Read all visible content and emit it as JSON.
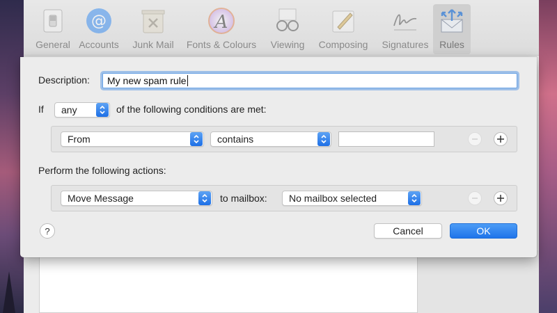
{
  "toolbar": {
    "items": [
      {
        "label": "General",
        "icon": "general-switch-icon"
      },
      {
        "label": "Accounts",
        "icon": "at-sign-icon"
      },
      {
        "label": "Junk Mail",
        "icon": "trash-x-icon"
      },
      {
        "label": "Fonts & Colours",
        "icon": "font-colour-icon"
      },
      {
        "label": "Viewing",
        "icon": "glasses-icon"
      },
      {
        "label": "Composing",
        "icon": "pencil-icon"
      },
      {
        "label": "Signatures",
        "icon": "signature-icon"
      },
      {
        "label": "Rules",
        "icon": "rules-envelope-icon"
      }
    ],
    "selected": "Rules"
  },
  "rule_sheet": {
    "description_label": "Description:",
    "description_value": "My new spam rule",
    "if_label": "If",
    "match_selector": "any",
    "conditions_suffix": "of the following conditions are met:",
    "condition": {
      "field": "From",
      "operator": "contains",
      "value": ""
    },
    "actions_label": "Perform the following actions:",
    "action": {
      "type": "Move Message",
      "to_label": "to mailbox:",
      "mailbox": "No mailbox selected"
    },
    "help_label": "?",
    "cancel_label": "Cancel",
    "ok_label": "OK"
  },
  "colors": {
    "accent": "#1f74ea",
    "focus_ring": "#6aa2e4",
    "sheet_bg": "#ececec"
  }
}
